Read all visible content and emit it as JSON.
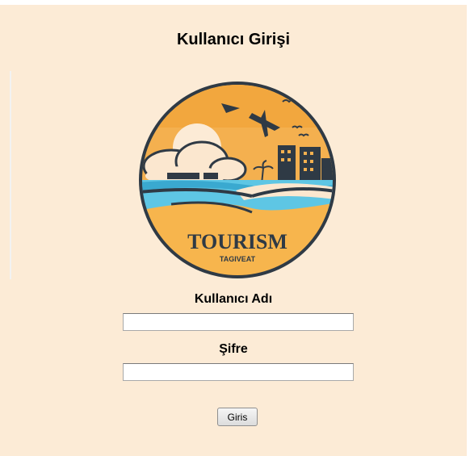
{
  "page": {
    "title": "Kullanıcı Girişi",
    "background_color": "#fcebd6"
  },
  "logo": {
    "icon": "tourism-logo-icon",
    "text": "TOURISM",
    "subtext": "TAGIVEAT"
  },
  "form": {
    "username_label": "Kullanıcı Adı",
    "username_value": "",
    "password_label": "Şifre",
    "password_value": "",
    "submit_label": "Giris"
  }
}
